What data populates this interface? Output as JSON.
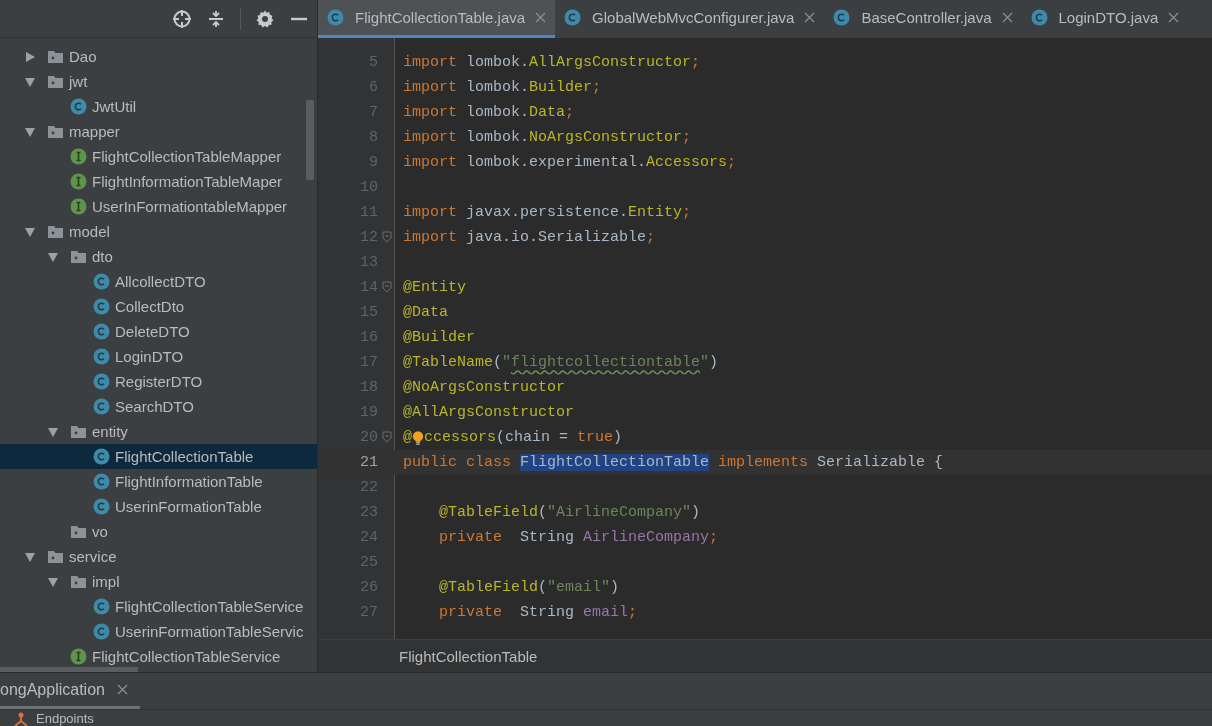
{
  "project_tree": [
    {
      "kind": "folder",
      "label": "Dao",
      "expanded": false,
      "selected": false
    },
    {
      "kind": "folder",
      "label": "jwt",
      "expanded": true,
      "selected": false,
      "children": [
        {
          "kind": "class",
          "label": "JwtUtil",
          "selected": false
        }
      ]
    },
    {
      "kind": "folder",
      "label": "mapper",
      "expanded": true,
      "selected": false,
      "children": [
        {
          "kind": "interface",
          "label": "FlightCollectionTableMapper",
          "selected": false
        },
        {
          "kind": "interface",
          "label": "FlightInformationTableMaper",
          "selected": false
        },
        {
          "kind": "interface",
          "label": "UserInFormationtableMapper",
          "selected": false
        }
      ]
    },
    {
      "kind": "folder",
      "label": "model",
      "expanded": true,
      "selected": false,
      "children": [
        {
          "kind": "folder",
          "label": "dto",
          "expanded": true,
          "selected": false,
          "children": [
            {
              "kind": "class",
              "label": "AllcollectDTO",
              "selected": false
            },
            {
              "kind": "class",
              "label": "CollectDto",
              "selected": false
            },
            {
              "kind": "class",
              "label": "DeleteDTO",
              "selected": false
            },
            {
              "kind": "class",
              "label": "LoginDTO",
              "selected": false
            },
            {
              "kind": "class",
              "label": "RegisterDTO",
              "selected": false
            },
            {
              "kind": "class",
              "label": "SearchDTO",
              "selected": false
            }
          ]
        },
        {
          "kind": "folder",
          "label": "entity",
          "expanded": true,
          "selected": false,
          "children": [
            {
              "kind": "class",
              "label": "FlightCollectionTable",
              "selected": true
            },
            {
              "kind": "class",
              "label": "FlightInformationTable",
              "selected": false
            },
            {
              "kind": "class",
              "label": "UserinFormationTable",
              "selected": false
            }
          ]
        },
        {
          "kind": "empty-folder",
          "label": "vo",
          "selected": false
        }
      ]
    },
    {
      "kind": "folder",
      "label": "service",
      "expanded": true,
      "selected": false,
      "children": [
        {
          "kind": "folder",
          "label": "impl",
          "expanded": true,
          "selected": false,
          "children": [
            {
              "kind": "class",
              "label": "FlightCollectionTableService",
              "selected": false
            },
            {
              "kind": "class",
              "label": "UserinFormationTableServic",
              "selected": false
            }
          ]
        },
        {
          "kind": "interface",
          "label": "FlightCollectionTableService",
          "selected": false
        }
      ]
    }
  ],
  "editor_tabs": [
    {
      "label": "FlightCollectionTable.java",
      "selected": true
    },
    {
      "label": "GlobalWebMvcConfigurer.java",
      "selected": false
    },
    {
      "label": "BaseController.java",
      "selected": false
    },
    {
      "label": "LoginDTO.java",
      "selected": false
    }
  ],
  "code_lines": [
    {
      "n": "5",
      "current": false,
      "fold": false,
      "tokens": [
        {
          "kind": "keyword",
          "text": "import"
        },
        {
          "kind": "plain",
          "text": " lombok."
        },
        {
          "kind": "imported",
          "text": "AllArgsConstructor"
        },
        {
          "kind": "keyword",
          "text": ";"
        }
      ]
    },
    {
      "n": "6",
      "current": false,
      "fold": false,
      "tokens": [
        {
          "kind": "keyword",
          "text": "import"
        },
        {
          "kind": "plain",
          "text": " lombok."
        },
        {
          "kind": "imported",
          "text": "Builder"
        },
        {
          "kind": "keyword",
          "text": ";"
        }
      ]
    },
    {
      "n": "7",
      "current": false,
      "fold": false,
      "tokens": [
        {
          "kind": "keyword",
          "text": "import"
        },
        {
          "kind": "plain",
          "text": " lombok."
        },
        {
          "kind": "imported",
          "text": "Data"
        },
        {
          "kind": "keyword",
          "text": ";"
        }
      ]
    },
    {
      "n": "8",
      "current": false,
      "fold": false,
      "tokens": [
        {
          "kind": "keyword",
          "text": "import"
        },
        {
          "kind": "plain",
          "text": " lombok."
        },
        {
          "kind": "imported",
          "text": "NoArgsConstructor"
        },
        {
          "kind": "keyword",
          "text": ";"
        }
      ]
    },
    {
      "n": "9",
      "current": false,
      "fold": false,
      "tokens": [
        {
          "kind": "keyword",
          "text": "import"
        },
        {
          "kind": "plain",
          "text": " lombok.experimental."
        },
        {
          "kind": "imported",
          "text": "Accessors"
        },
        {
          "kind": "keyword",
          "text": ";"
        }
      ]
    },
    {
      "n": "10",
      "current": false,
      "fold": false
    },
    {
      "n": "11",
      "current": false,
      "fold": false,
      "tokens": [
        {
          "kind": "keyword",
          "text": "import"
        },
        {
          "kind": "plain",
          "text": " javax.persistence."
        },
        {
          "kind": "imported",
          "text": "Entity"
        },
        {
          "kind": "keyword",
          "text": ";"
        }
      ]
    },
    {
      "n": "12",
      "current": false,
      "fold": true,
      "tokens": [
        {
          "kind": "keyword",
          "text": "import"
        },
        {
          "kind": "plain",
          "text": " java.io.Serializable"
        },
        {
          "kind": "keyword",
          "text": ";"
        }
      ]
    },
    {
      "n": "13",
      "current": false,
      "fold": false
    },
    {
      "n": "14",
      "current": false,
      "fold": true,
      "tokens": [
        {
          "kind": "annotation",
          "text": "@Entity"
        }
      ]
    },
    {
      "n": "15",
      "current": false,
      "fold": false,
      "tokens": [
        {
          "kind": "annotation",
          "text": "@Data"
        }
      ]
    },
    {
      "n": "16",
      "current": false,
      "fold": false,
      "tokens": [
        {
          "kind": "annotation",
          "text": "@Builder"
        }
      ]
    },
    {
      "n": "17",
      "current": false,
      "fold": false,
      "tokens": [
        {
          "kind": "annotation",
          "text": "@TableName"
        },
        {
          "kind": "plain",
          "text": "("
        },
        {
          "kind": "string",
          "text": "\""
        },
        {
          "kind": "string-typo",
          "text": "flightcollectiontable"
        },
        {
          "kind": "string",
          "text": "\""
        },
        {
          "kind": "plain",
          "text": ")"
        }
      ]
    },
    {
      "n": "18",
      "current": false,
      "fold": false,
      "tokens": [
        {
          "kind": "annotation",
          "text": "@NoArgsConstructor"
        }
      ]
    },
    {
      "n": "19",
      "current": false,
      "fold": false,
      "tokens": [
        {
          "kind": "annotation",
          "text": "@AllArgsConstructor"
        }
      ]
    },
    {
      "n": "20",
      "current": false,
      "fold": true,
      "tokens": [
        {
          "kind": "annotation",
          "text": "@"
        },
        {
          "kind": "bulb"
        },
        {
          "kind": "annotation",
          "text": "ccessors"
        },
        {
          "kind": "plain",
          "text": "(chain = "
        },
        {
          "kind": "keyword",
          "text": "true"
        },
        {
          "kind": "plain",
          "text": ")"
        }
      ]
    },
    {
      "n": "21",
      "current": true,
      "fold": false,
      "tokens": [
        {
          "kind": "keyword",
          "text": "public class "
        },
        {
          "kind": "selection",
          "text": "FlightCollectionTable"
        },
        {
          "kind": "keyword",
          "text": " implements "
        },
        {
          "kind": "plain",
          "text": "Serializable {"
        }
      ]
    },
    {
      "n": "22",
      "current": false,
      "fold": false
    },
    {
      "n": "23",
      "current": false,
      "fold": false,
      "tokens": [
        {
          "kind": "annotation",
          "text": "    @TableField"
        },
        {
          "kind": "plain",
          "text": "("
        },
        {
          "kind": "string",
          "text": "\"AirlineCompany\""
        },
        {
          "kind": "plain",
          "text": ")"
        }
      ]
    },
    {
      "n": "24",
      "current": false,
      "fold": false,
      "tokens": [
        {
          "kind": "keyword",
          "text": "    private  "
        },
        {
          "kind": "plain",
          "text": "String "
        },
        {
          "kind": "field",
          "text": "AirlineCompany"
        },
        {
          "kind": "keyword",
          "text": ";"
        }
      ]
    },
    {
      "n": "25",
      "current": false,
      "fold": false
    },
    {
      "n": "26",
      "current": false,
      "fold": false,
      "tokens": [
        {
          "kind": "annotation",
          "text": "    @TableField"
        },
        {
          "kind": "plain",
          "text": "("
        },
        {
          "kind": "string",
          "text": "\"email\""
        },
        {
          "kind": "plain",
          "text": ")"
        }
      ]
    },
    {
      "n": "27",
      "current": false,
      "fold": false,
      "tokens": [
        {
          "kind": "keyword",
          "text": "    private  "
        },
        {
          "kind": "plain",
          "text": "String "
        },
        {
          "kind": "field",
          "text": "email"
        },
        {
          "kind": "keyword",
          "text": ";"
        }
      ]
    }
  ],
  "breadcrumb": "FlightCollectionTable",
  "bottom_panel": {
    "tab": "ongApplication",
    "item": "Endpoints"
  }
}
